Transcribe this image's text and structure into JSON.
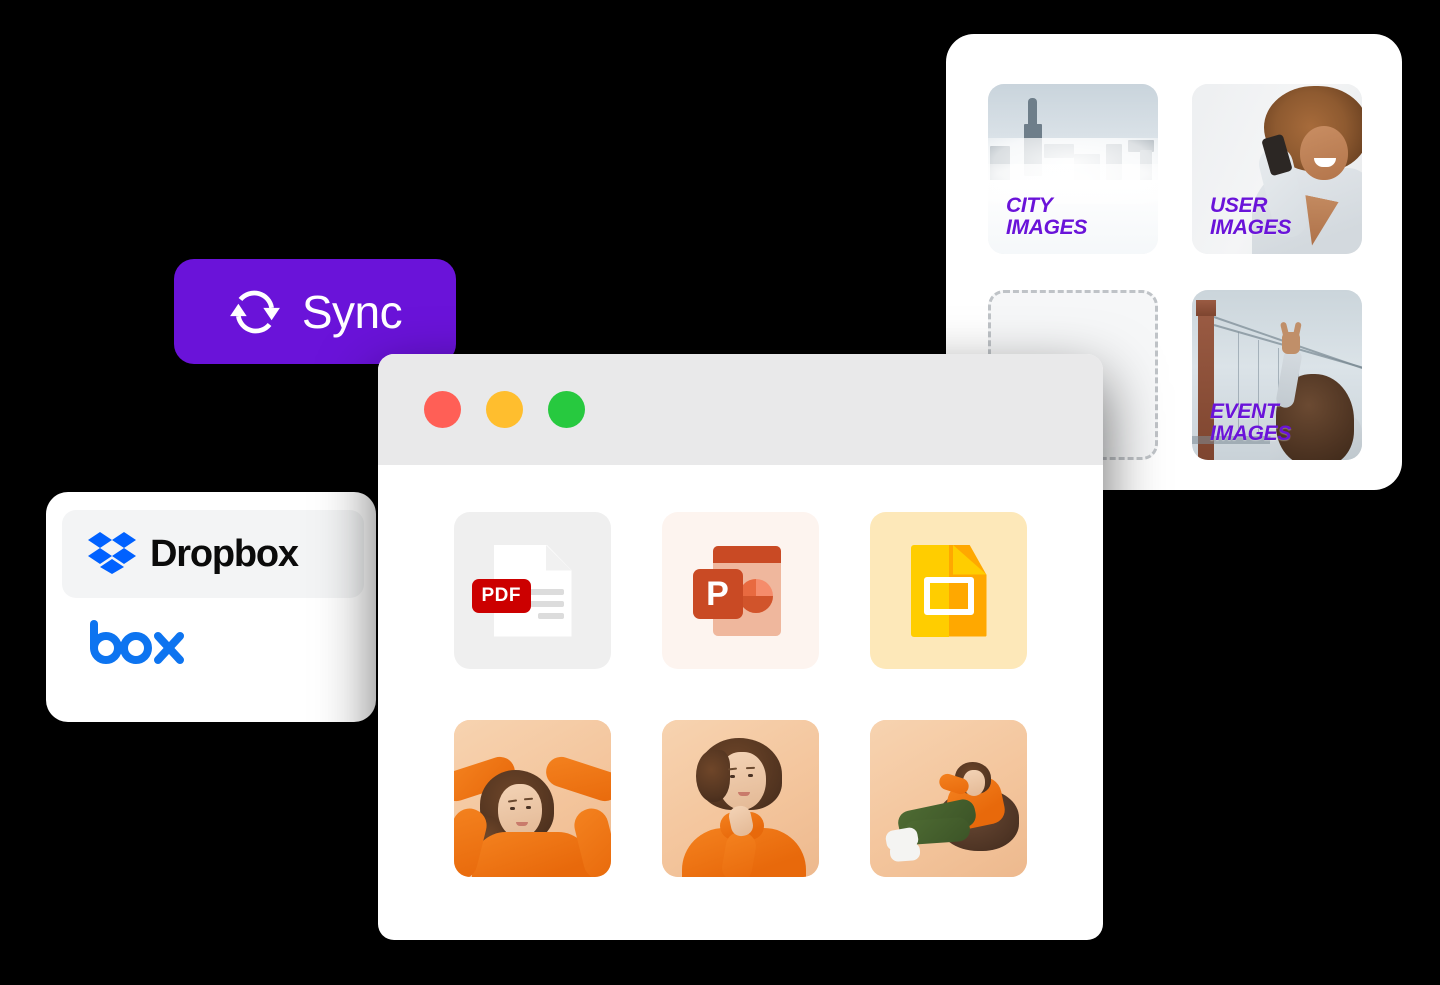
{
  "theme": {
    "background": "#000000",
    "brand_purple": "#6A13D9",
    "dropbox_blue": "#0061FF",
    "box_blue": "#0D74F0",
    "card_white": "#FFFFFF",
    "titlebar_gray": "#E9E9EA",
    "dot_red": "#FF5F56",
    "dot_amber": "#FFBE2E",
    "dot_green": "#27C93F"
  },
  "sync_button": {
    "label": "Sync",
    "icon": "sync-arrows-icon",
    "background": "#6A13D9",
    "text_color": "#FFFFFF"
  },
  "cloud_panel": {
    "providers": [
      {
        "name": "Dropbox",
        "icon": "dropbox-logo-icon",
        "selected": true,
        "color": "#0061FF"
      },
      {
        "name": "box",
        "icon": "box-logo-icon",
        "selected": false,
        "color": "#0D74F0"
      }
    ]
  },
  "gallery_panel": {
    "tiles": [
      {
        "label": "CITY\nIMAGES",
        "art": "city-skyline-fog",
        "type": "image",
        "text_color": "#6A13D9"
      },
      {
        "label": "USER\nIMAGES",
        "art": "woman-with-phone",
        "type": "image",
        "text_color": "#6A13D9"
      },
      {
        "label": "",
        "art": "empty-placeholder",
        "type": "placeholder",
        "text_color": ""
      },
      {
        "label": "EVENT\nIMAGES",
        "art": "woman-at-bridge",
        "type": "image",
        "text_color": "#6A13D9"
      }
    ]
  },
  "browser_window": {
    "traffic_lights": [
      {
        "name": "close",
        "color": "#FF5F56"
      },
      {
        "name": "minimize",
        "color": "#FFBE2E"
      },
      {
        "name": "maximize",
        "color": "#27C93F"
      }
    ],
    "files": [
      {
        "name": "PDF",
        "kind": "pdf",
        "badge": "PDF",
        "tile_color": "#EFEFEF"
      },
      {
        "name": "P",
        "kind": "ppt",
        "badge": "P",
        "tile_color": "#FDF4EF"
      },
      {
        "name": "Slides",
        "kind": "slides",
        "badge": "",
        "tile_color": "#FDE8B9"
      }
    ],
    "photos": [
      {
        "name": "woman-hands-behind-head",
        "kind": "photo"
      },
      {
        "name": "woman-hand-on-chin",
        "kind": "photo"
      },
      {
        "name": "woman-on-beanbag",
        "kind": "photo"
      }
    ]
  }
}
